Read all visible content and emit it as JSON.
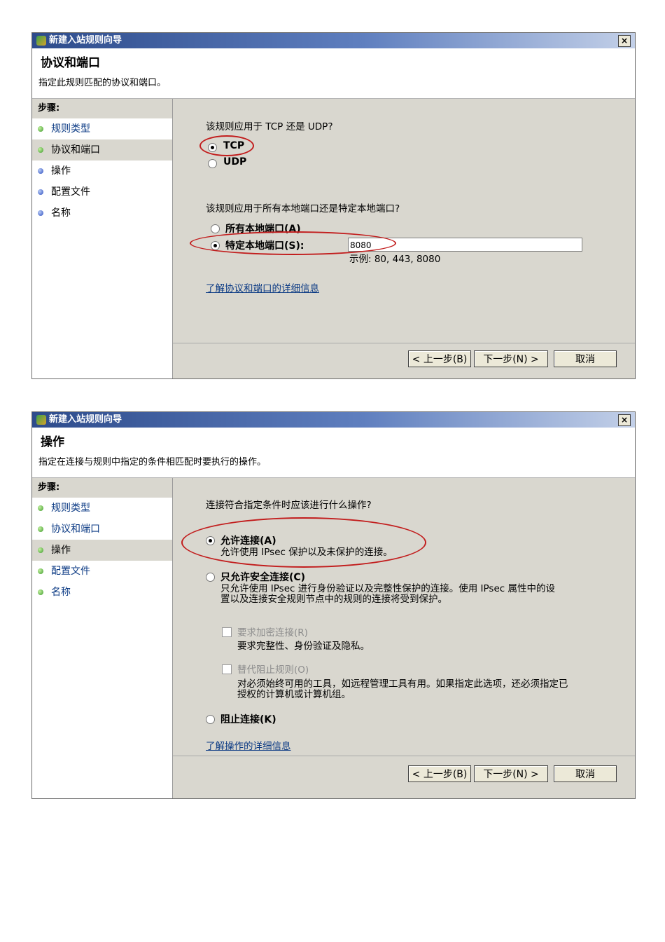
{
  "dialog1": {
    "title": "新建入站规则向导",
    "close": "×",
    "header_title": "协议和端口",
    "header_sub": "指定此规则匹配的协议和端口。",
    "steps_head": "步骤:",
    "steps": [
      "规则类型",
      "协议和端口",
      "操作",
      "配置文件",
      "名称"
    ],
    "q_protocol": "该规则应用于 TCP 还是 UDP?",
    "opt_tcp": "TCP",
    "opt_udp": "UDP",
    "q_ports": "该规则应用于所有本地端口还是特定本地端口?",
    "opt_all_ports": "所有本地端口(A)",
    "opt_specific_ports": "特定本地端口(S):",
    "port_value": "8080",
    "port_example": "示例: 80, 443, 8080",
    "link": "了解协议和端口的详细信息",
    "btn_back": "< 上一步(B)",
    "btn_next": "下一步(N) >",
    "btn_cancel": "取消"
  },
  "dialog2": {
    "title": "新建入站规则向导",
    "close": "×",
    "header_title": "操作",
    "header_sub": "指定在连接与规则中指定的条件相匹配时要执行的操作。",
    "steps_head": "步骤:",
    "steps": [
      "规则类型",
      "协议和端口",
      "操作",
      "配置文件",
      "名称"
    ],
    "question": "连接符合指定条件时应该进行什么操作?",
    "opt_allow": "允许连接(A)",
    "opt_allow_desc": "允许使用 IPsec 保护以及未保护的连接。",
    "opt_secure": "只允许安全连接(C)",
    "opt_secure_desc_1": "只允许使用 IPsec 进行身份验证以及完整性保护的连接。使用 IPsec 属性中的设",
    "opt_secure_desc_2": "置以及连接安全规则节点中的规则的连接将受到保护。",
    "chk_encrypt": "要求加密连接(R)",
    "chk_encrypt_desc": "要求完整性、身份验证及隐私。",
    "chk_override": "替代阻止规则(O)",
    "chk_override_desc_1": "对必须始终可用的工具，如远程管理工具有用。如果指定此选项，还必须指定已",
    "chk_override_desc_2": "授权的计算机或计算机组。",
    "opt_block": "阻止连接(K)",
    "link": "了解操作的详细信息",
    "btn_back": "< 上一步(B)",
    "btn_next": "下一步(N) >",
    "btn_cancel": "取消"
  }
}
